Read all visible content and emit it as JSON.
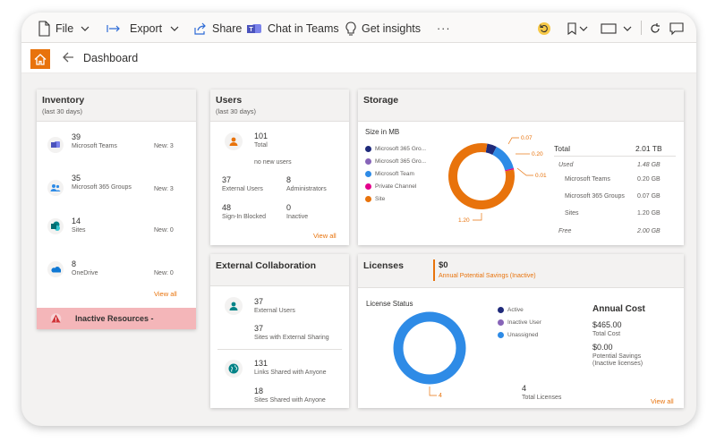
{
  "toolbar": {
    "file_label": "File",
    "export_label": "Export",
    "share_label": "Share",
    "teams_label": "Chat in Teams",
    "insights_label": "Get insights",
    "more_label": "···"
  },
  "nav": {
    "title": "Dashboard"
  },
  "inventory": {
    "title": "Inventory",
    "subtitle": "(last 30 days)",
    "items": [
      {
        "count": "39",
        "name": "Microsoft Teams",
        "new": "New: 3"
      },
      {
        "count": "35",
        "name": "Microsoft 365 Groups",
        "new": "New: 3"
      },
      {
        "count": "14",
        "name": "Sites",
        "new": "New: 0"
      },
      {
        "count": "8",
        "name": "OneDrive",
        "new": "New: 0"
      }
    ],
    "view_all": "View all",
    "inactive_label": "Inactive Resources -"
  },
  "users": {
    "title": "Users",
    "subtitle": "(last 30 days)",
    "total_count": "101",
    "total_label": "Total",
    "no_new": "no new users",
    "external_count": "37",
    "external_label": "External Users",
    "admins_count": "8",
    "admins_label": "Administrators",
    "blocked_count": "48",
    "blocked_label": "Sign-In Blocked",
    "inactive_count": "0",
    "inactive_label": "Inactive",
    "view_all": "View all"
  },
  "storage": {
    "title": "Storage",
    "size_label": "Size in MB",
    "legend": [
      {
        "name": "Microsoft 365 Gro...",
        "color": "#1f2a7a"
      },
      {
        "name": "Microsoft 365 Gro...",
        "color": "#8764b8"
      },
      {
        "name": "Microsoft Team",
        "color": "#2e8be6"
      },
      {
        "name": "Private Channel",
        "color": "#e3008c"
      },
      {
        "name": "Site",
        "color": "#e8730c"
      }
    ],
    "callouts": {
      "a": "0.07",
      "b": "0.20",
      "c": "0.01",
      "d": "1.20"
    },
    "total_label": "Total",
    "total_value": "2.01 TB",
    "used_label": "Used",
    "used_value": "1.48 GB",
    "rows": [
      {
        "name": "Microsoft Teams",
        "value": "0.20 GB"
      },
      {
        "name": "Microsoft 365 Groups",
        "value": "0.07 GB"
      },
      {
        "name": "Sites",
        "value": "1.20 GB"
      }
    ],
    "free_label": "Free",
    "free_value": "2.00 GB"
  },
  "external": {
    "title": "External Collaboration",
    "ext_users_count": "37",
    "ext_users_label": "External Users",
    "sites_ext_count": "37",
    "sites_ext_label": "Sites with External Sharing",
    "links_count": "131",
    "links_label": "Links Shared with Anyone",
    "sites_anyone_count": "18",
    "sites_anyone_label": "Sites Shared with Anyone"
  },
  "licenses": {
    "title": "Licenses",
    "savings_value": "$0",
    "savings_label": "Annual Potential Savings (Inactive)",
    "status_label": "License Status",
    "legend": [
      {
        "name": "Active",
        "color": "#1f2a7a"
      },
      {
        "name": "Inactive User",
        "color": "#8764b8"
      },
      {
        "name": "Unassigned",
        "color": "#2e8be6"
      }
    ],
    "donut_callout": "4",
    "total_count": "4",
    "total_label": "Total Licenses",
    "annual_cost_title": "Annual Cost",
    "total_cost_value": "$465.00",
    "total_cost_label": "Total Cost",
    "potential_value": "$0.00",
    "potential_label_1": "Potential Savings",
    "potential_label_2": "(Inactive licenses)",
    "view_all": "View all"
  },
  "chart_data": [
    {
      "type": "pie",
      "title": "Size in MB",
      "categories": [
        "Microsoft 365 Gro...",
        "Microsoft 365 Gro...",
        "Microsoft Team",
        "Private Channel",
        "Site"
      ],
      "values": [
        0.07,
        0,
        0.2,
        0.01,
        1.2
      ]
    },
    {
      "type": "pie",
      "title": "License Status",
      "categories": [
        "Active",
        "Inactive User",
        "Unassigned"
      ],
      "values": [
        0,
        0,
        4
      ]
    }
  ]
}
